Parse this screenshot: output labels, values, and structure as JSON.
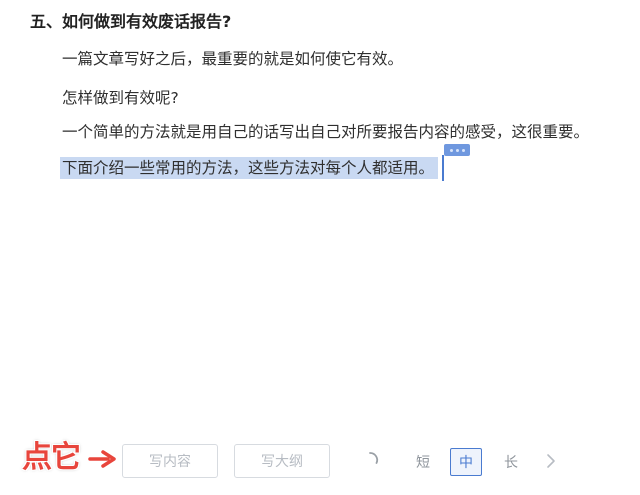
{
  "document": {
    "heading": "五、如何做到有效废话报告?",
    "paragraphs": [
      "一篇文章写好之后，最重要的就是如何使它有效。",
      "怎样做到有效呢?",
      "一个简单的方法就是用自己的话写出自己对所要报告内容的感受，这很重要。"
    ],
    "selected_paragraph": "下面介绍一些常用的方法，这些方法对每个人都适用。"
  },
  "annotation": {
    "label": "点它",
    "arrow_icon": "arrow-right-icon",
    "color": "#e8453c"
  },
  "toolbar": {
    "write_content_label": "写内容",
    "write_outline_label": "写大纲",
    "loading_icon": "spinner-icon",
    "length_options": [
      "短",
      "中",
      "长"
    ],
    "length_selected": "中",
    "next_icon": "chevron-right-icon",
    "accent_color": "#4a7bd0",
    "disabled_text_color": "#b7bcc3"
  }
}
